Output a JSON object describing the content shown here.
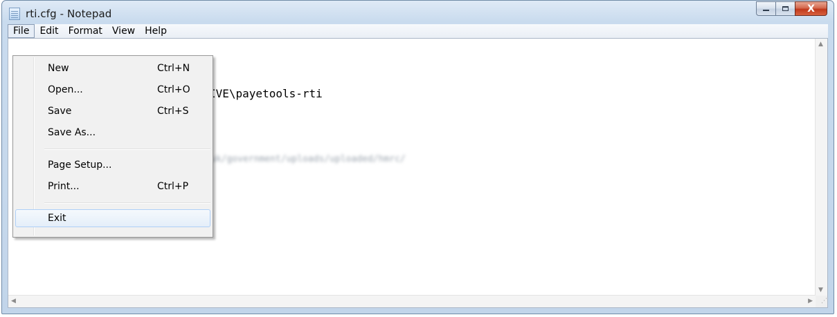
{
  "window": {
    "title": "rti.cfg - Notepad"
  },
  "caption": {
    "close_glyph": "X"
  },
  "menubar": {
    "items": [
      "File",
      "Edit",
      "Format",
      "View",
      "Help"
    ]
  },
  "editor": {
    "lines": [
      {
        "text": "IVE\\payetools-rti"
      },
      {
        "text": "uk/government/uploads/uploaded/hmrc/"
      }
    ]
  },
  "file_menu": {
    "items": [
      {
        "label": "New",
        "shortcut": "Ctrl+N"
      },
      {
        "label": "Open...",
        "shortcut": "Ctrl+O"
      },
      {
        "label": "Save",
        "shortcut": "Ctrl+S"
      },
      {
        "label": "Save As...",
        "shortcut": ""
      },
      {
        "label": "Page Setup...",
        "shortcut": ""
      },
      {
        "label": "Print...",
        "shortcut": "Ctrl+P"
      },
      {
        "label": "Exit",
        "shortcut": ""
      }
    ],
    "hovered": "Exit"
  },
  "icons": [
    "notepad-icon",
    "minimize-icon",
    "maximize-icon",
    "close-icon",
    "scroll-up-icon",
    "scroll-down-icon",
    "scroll-left-icon",
    "scroll-right-icon",
    "resize-grip-icon"
  ]
}
